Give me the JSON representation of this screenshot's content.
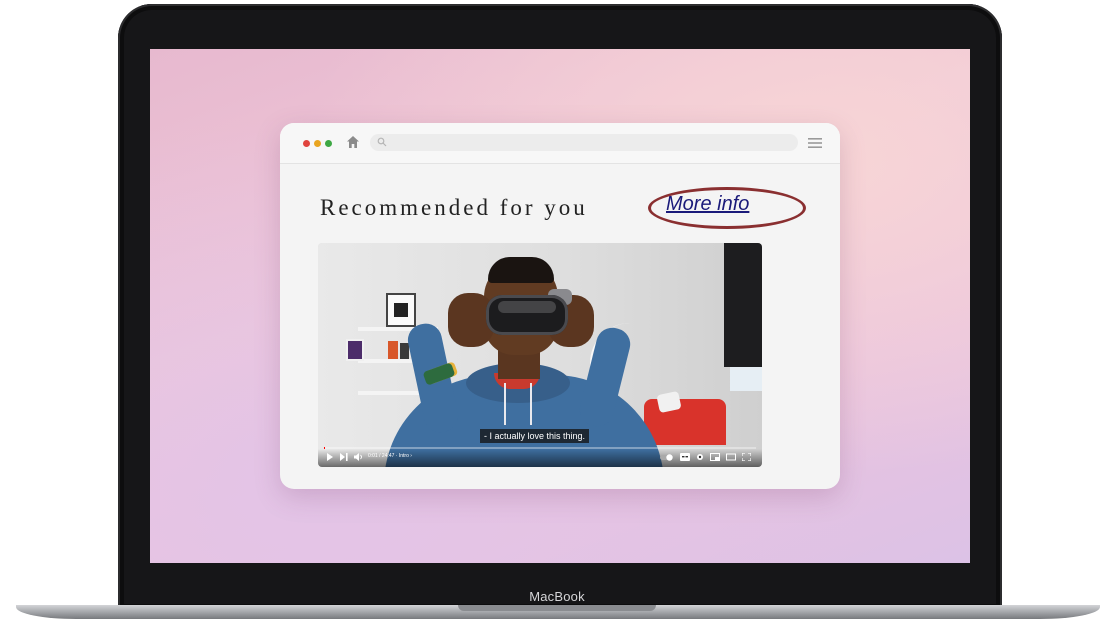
{
  "device": {
    "brand_label": "MacBook"
  },
  "browser": {
    "address_bar": {
      "value": ""
    }
  },
  "content": {
    "heading": "Recommended for you",
    "more_info_link": "More info"
  },
  "video": {
    "caption": "- I actually love this thing.",
    "time_readout": "0:01 / 24:47 · Intro ›",
    "progress_fraction": 0.002
  },
  "colors": {
    "highlight_circle": "#8a2f30",
    "progress": "#ff0000"
  },
  "icons": [
    "home-icon",
    "search-icon",
    "hamburger-menu-icon",
    "play-icon",
    "next-icon",
    "volume-icon",
    "autoplay-toggle-icon",
    "subtitles-icon",
    "settings-icon",
    "miniplayer-icon",
    "theater-mode-icon",
    "fullscreen-icon"
  ]
}
